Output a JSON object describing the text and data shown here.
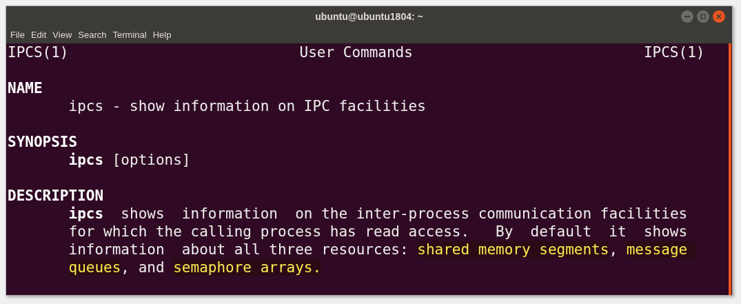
{
  "window": {
    "title": "ubuntu@ubuntu1804: ~"
  },
  "menu": [
    "File",
    "Edit",
    "View",
    "Search",
    "Terminal",
    "Help"
  ],
  "header": {
    "left": "IPCS(1)",
    "center": "User Commands",
    "right": "IPCS(1)"
  },
  "sections": [
    {
      "heading": "NAME",
      "lines": [
        [
          {
            "text": "ipcs - show information on IPC facilities",
            "kind": "normal"
          }
        ]
      ]
    },
    {
      "heading": "SYNOPSIS",
      "lines": [
        [
          {
            "text": "ipcs",
            "kind": "bold"
          },
          {
            "text": " [options]",
            "kind": "normal"
          }
        ]
      ]
    },
    {
      "heading": "DESCRIPTION",
      "lines": [
        [
          {
            "text": "ipcs",
            "kind": "bold"
          },
          {
            "text": "  shows  information  on the inter-process communication facilities",
            "kind": "normal"
          }
        ],
        [
          {
            "text": "for which the calling process has read access.   By  default  it  shows",
            "kind": "normal"
          }
        ],
        [
          {
            "text": "information  about all three resources: ",
            "kind": "normal"
          },
          {
            "text": "shared memory segments",
            "kind": "highlight"
          },
          {
            "text": ", ",
            "kind": "normal"
          },
          {
            "text": "message ",
            "kind": "highlight"
          }
        ],
        [
          {
            "text": "queues",
            "kind": "highlight"
          },
          {
            "text": ", and ",
            "kind": "normal"
          },
          {
            "text": "semaphore arrays.",
            "kind": "highlight"
          }
        ]
      ]
    }
  ]
}
